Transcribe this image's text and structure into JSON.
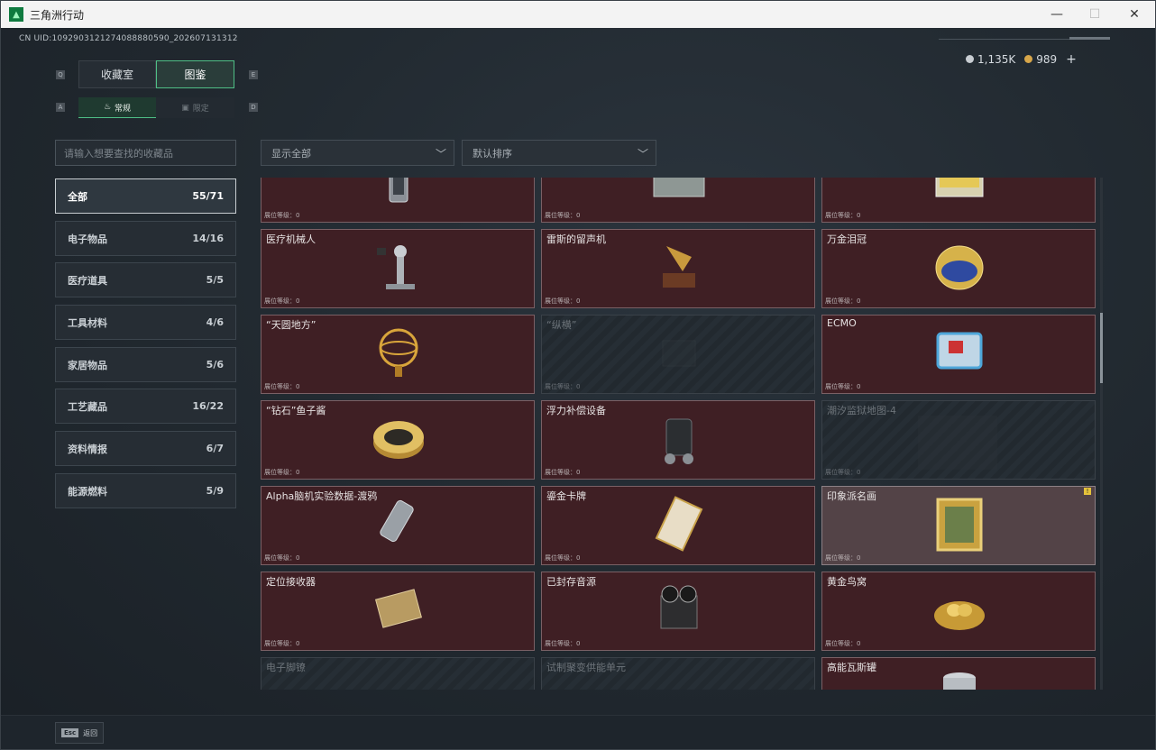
{
  "window": {
    "title": "三角洲行动",
    "minimize": "—",
    "maximize": "☐",
    "close": "✕"
  },
  "header": {
    "uid": "CN UID:1092903121274088880590_202607131312",
    "currency": [
      {
        "icon": "silver-coin-icon",
        "value": "1,135K",
        "color": "#c8cdd2"
      },
      {
        "icon": "gold-coin-icon",
        "value": "989",
        "color": "#d7a64a"
      }
    ],
    "add_label": "+"
  },
  "tabs": {
    "left_key": "Q",
    "right_key": "E",
    "items": [
      {
        "label": "收藏室",
        "active": false
      },
      {
        "label": "图鉴",
        "active": true
      }
    ],
    "sub_left_key": "A",
    "sub_right_key": "D",
    "sub_items": [
      {
        "label": "常规",
        "icon": "flame-icon",
        "active": true
      },
      {
        "label": "限定",
        "icon": "box-icon",
        "active": false
      }
    ]
  },
  "filters": {
    "search_placeholder": "请输入想要查找的收藏品",
    "display_filter": "显示全部",
    "sort_order": "默认排序"
  },
  "categories": [
    {
      "label": "全部",
      "count": "55/71",
      "active": true
    },
    {
      "label": "电子物品",
      "count": "14/16",
      "active": false
    },
    {
      "label": "医疗道具",
      "count": "5/5",
      "active": false
    },
    {
      "label": "工具材料",
      "count": "4/6",
      "active": false
    },
    {
      "label": "家居物品",
      "count": "5/6",
      "active": false
    },
    {
      "label": "工艺藏品",
      "count": "16/22",
      "active": false
    },
    {
      "label": "资料情报",
      "count": "6/7",
      "active": false
    },
    {
      "label": "能源燃料",
      "count": "5/9",
      "active": false
    }
  ],
  "level_label": "展位等级：0",
  "items": [
    {
      "name": "",
      "icon": "canister-device-icon",
      "state": "owned"
    },
    {
      "name": "",
      "icon": "military-crate-icon",
      "state": "owned"
    },
    {
      "name": "",
      "icon": "battery-pack-icon",
      "state": "owned"
    },
    {
      "name": "医疗机械人",
      "icon": "medical-robot-icon",
      "state": "owned"
    },
    {
      "name": "雷斯的留声机",
      "icon": "gramophone-icon",
      "state": "owned"
    },
    {
      "name": "万金泪冠",
      "icon": "jeweled-egg-icon",
      "state": "owned"
    },
    {
      "name": "“天圆地方”",
      "icon": "armillary-sphere-icon",
      "state": "owned"
    },
    {
      "name": "“纵横”",
      "icon": "chess-board-icon",
      "state": "locked"
    },
    {
      "name": "ECMO",
      "icon": "ecmo-machine-icon",
      "state": "owned"
    },
    {
      "name": "“钻石”鱼子酱",
      "icon": "caviar-tin-icon",
      "state": "owned"
    },
    {
      "name": "浮力补偿设备",
      "icon": "diving-gear-icon",
      "state": "owned"
    },
    {
      "name": "潮汐监狱地图-4",
      "icon": "map-icon",
      "state": "locked"
    },
    {
      "name": "Alpha脑机实验数据-渡鸦",
      "icon": "data-drive-icon",
      "state": "owned"
    },
    {
      "name": "鎏金卡牌",
      "icon": "gilded-card-icon",
      "state": "owned"
    },
    {
      "name": "印象派名画",
      "icon": "framed-painting-icon",
      "state": "selected",
      "badge": "!"
    },
    {
      "name": "定位接收器",
      "icon": "gps-receiver-icon",
      "state": "owned"
    },
    {
      "name": "已封存音源",
      "icon": "reel-recorder-icon",
      "state": "owned"
    },
    {
      "name": "黄金鸟窝",
      "icon": "golden-nest-icon",
      "state": "owned"
    },
    {
      "name": "电子脚镣",
      "icon": "ankle-monitor-icon",
      "state": "locked"
    },
    {
      "name": "试制聚变供能单元",
      "icon": "fusion-cell-icon",
      "state": "locked"
    },
    {
      "name": "高能瓦斯罐",
      "icon": "gas-canister-icon",
      "state": "owned"
    }
  ],
  "footer": {
    "esc_key": "Esc",
    "back_label": "返回"
  }
}
